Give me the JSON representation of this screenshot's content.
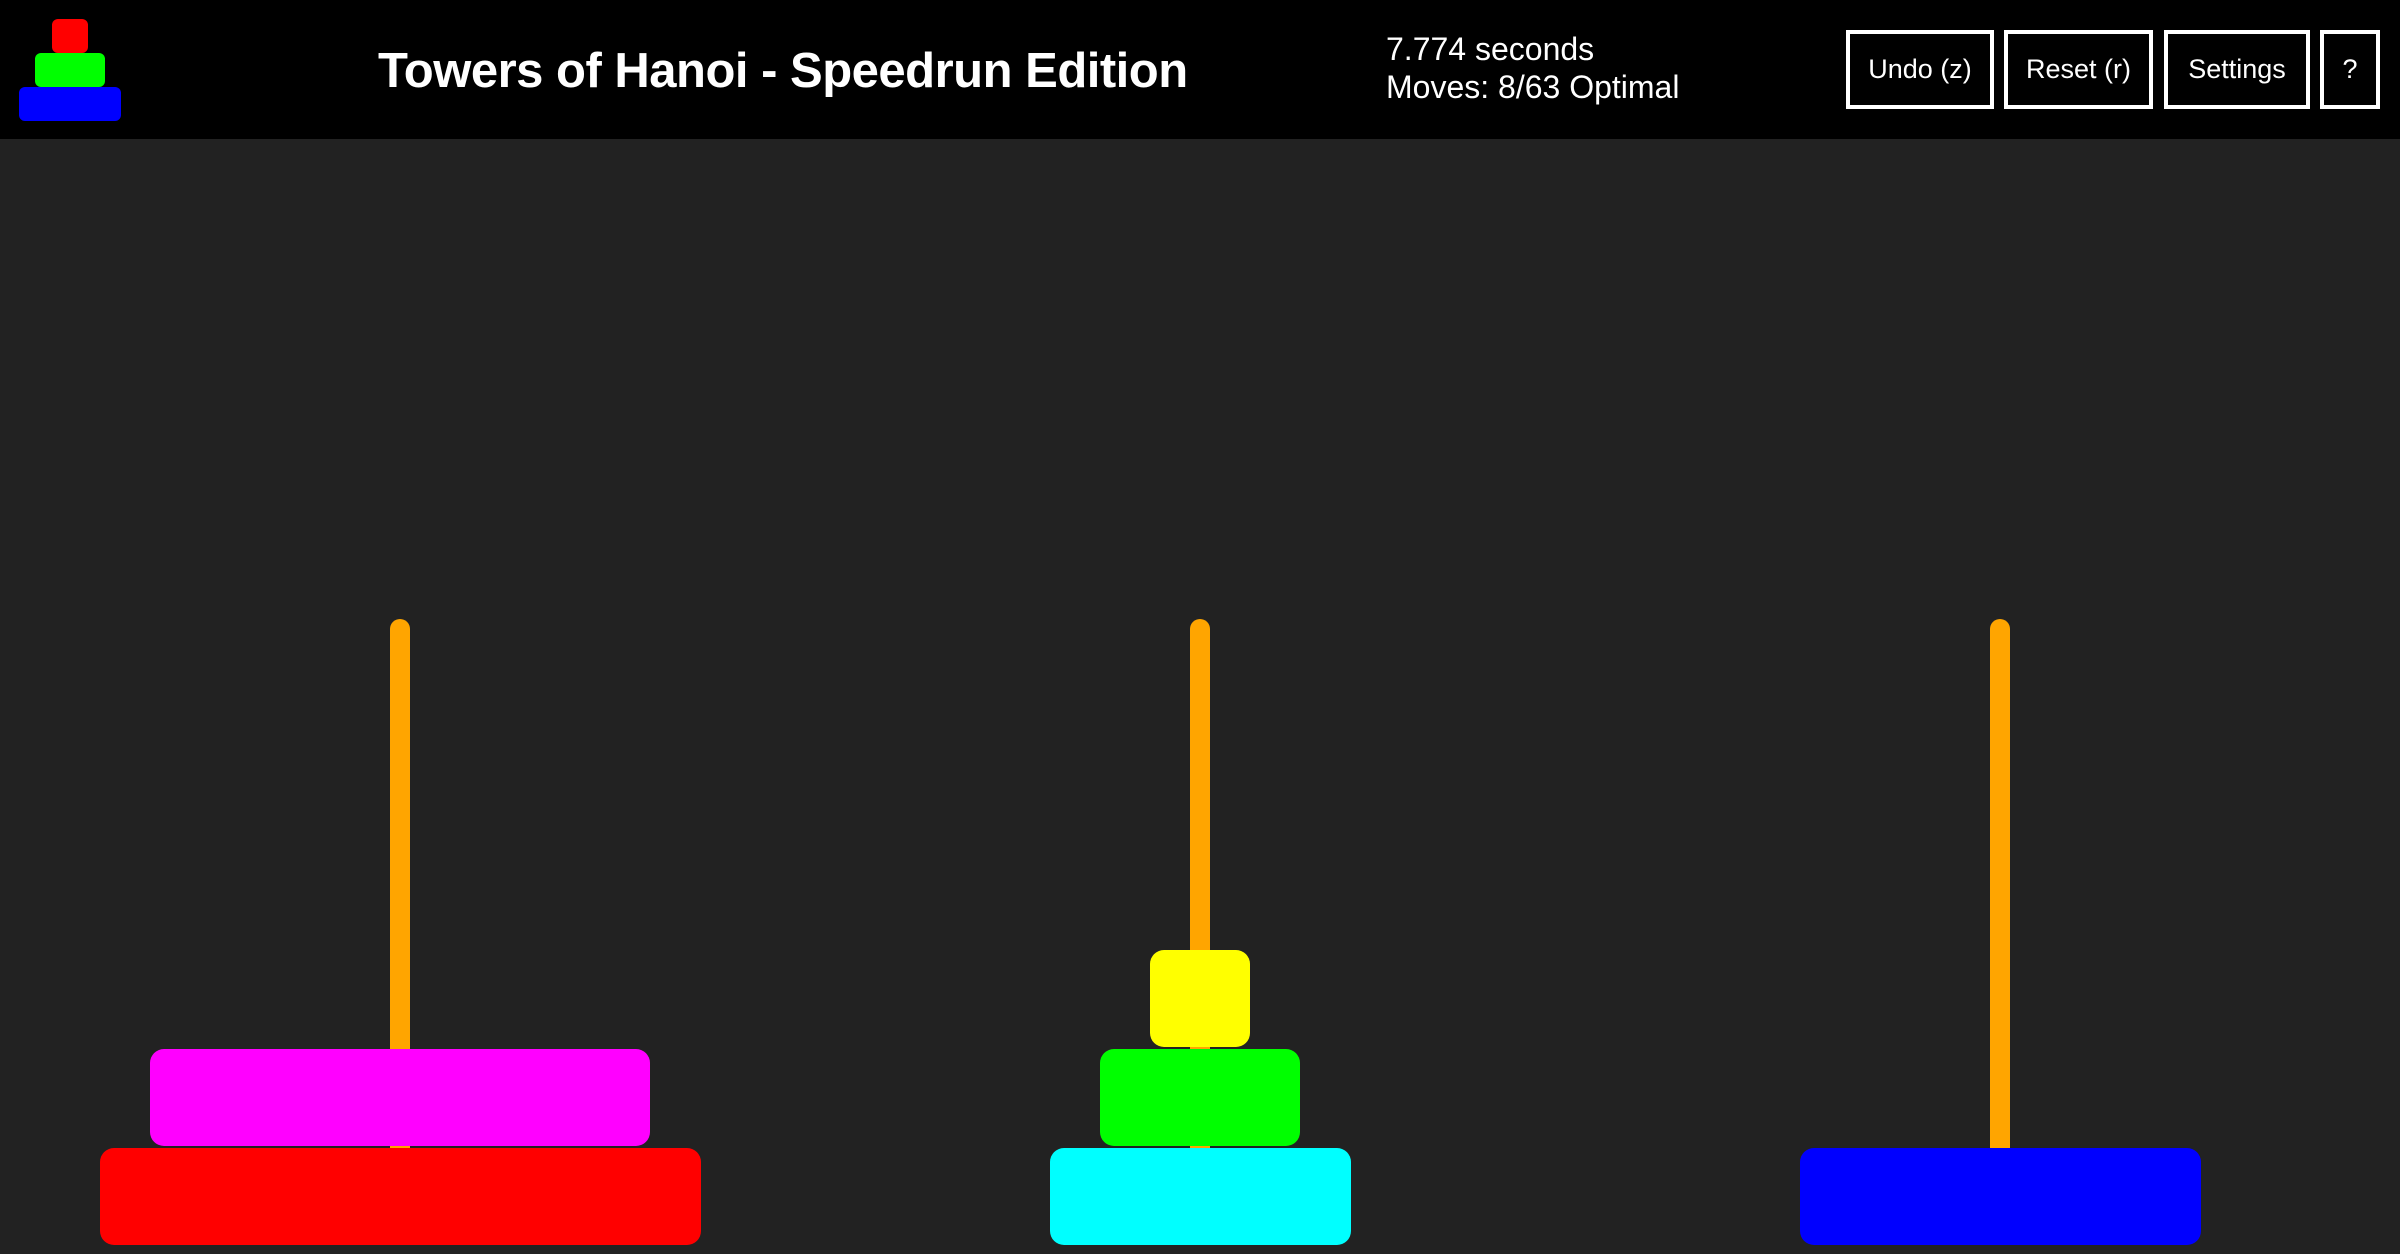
{
  "header": {
    "title": "Towers of Hanoi - Speedrun Edition",
    "timer": "7.774 seconds",
    "moves": "Moves: 8/63 Optimal",
    "buttons": {
      "undo": "Undo (z)",
      "reset": "Reset (r)",
      "settings": "Settings",
      "help": "?"
    },
    "logo_colors": [
      "#ff0000",
      "#00ff00",
      "#0000ff"
    ]
  },
  "game": {
    "background_color": "#222222",
    "peg_color": "#ffa500",
    "pegs": [
      {
        "name": "left",
        "disks": [
          {
            "size": 6,
            "color": "#ff0000"
          },
          {
            "size": 5,
            "color": "#ff00ff"
          }
        ]
      },
      {
        "name": "middle",
        "disks": [
          {
            "size": 3,
            "color": "#00ffff"
          },
          {
            "size": 2,
            "color": "#00ff00"
          },
          {
            "size": 1,
            "color": "#ffff00"
          }
        ]
      },
      {
        "name": "right",
        "disks": [
          {
            "size": 4,
            "color": "#0000ff"
          }
        ]
      }
    ]
  }
}
